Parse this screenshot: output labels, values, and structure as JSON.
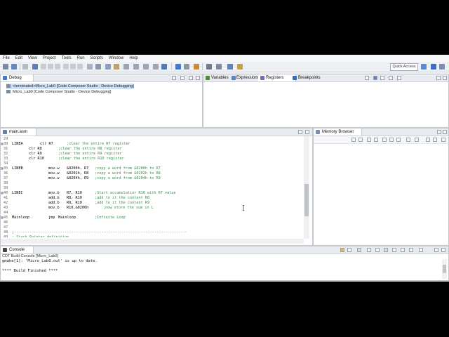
{
  "menu": [
    "File",
    "Edit",
    "View",
    "Project",
    "Tools",
    "Run",
    "Scripts",
    "Window",
    "Help"
  ],
  "toolbar": {
    "quick_access": "Quick Access"
  },
  "debug_view": {
    "tab": "Debug",
    "items": [
      {
        "label": "<terminated>Micro_Lab0 [Code Composer Studio - Device Debugging]",
        "selected": true
      },
      {
        "label": "Micro_Lab0 [Code Composer Studio - Device Debugging]",
        "selected": false
      }
    ]
  },
  "variables_view": {
    "tabs": [
      "Variables",
      "Expressions",
      "Registers",
      "Breakpoints"
    ],
    "active": "Registers"
  },
  "editor": {
    "tab": "main.asm",
    "lines": [
      {
        "n": "29",
        "label": "",
        "ins": "",
        "ops": "",
        "comment": ""
      },
      {
        "n": "30",
        "label": "LINEA",
        "ins": "clr R7",
        "ops": "",
        "comment": ";clear the entire R7 register"
      },
      {
        "n": "31",
        "label": "",
        "ins": "clr R8",
        "ops": "",
        "comment": ";clear the entire R8 register"
      },
      {
        "n": "32",
        "label": "",
        "ins": "clr R9",
        "ops": "",
        "comment": ";clear the entire R9 register"
      },
      {
        "n": "33",
        "label": "",
        "ins": "clr R10",
        "ops": "",
        "comment": ";clear the entire R10 register"
      },
      {
        "n": "34",
        "label": "",
        "ins": "",
        "ops": "",
        "comment": ""
      },
      {
        "n": "35",
        "label": "LINEB",
        "ins": "mov.w",
        "ops": "&0200h, R7",
        "comment": ";copy a word from &0200h to R7"
      },
      {
        "n": "36",
        "label": "",
        "ins": "mov.w",
        "ops": "&0202h, R8",
        "comment": ";copy a word from &0202h to R8"
      },
      {
        "n": "37",
        "label": "",
        "ins": "mov.w",
        "ops": "&0204h, R9",
        "comment": ";copy a word from &0204h to R9"
      },
      {
        "n": "38",
        "label": "",
        "ins": "",
        "ops": "",
        "comment": ""
      },
      {
        "n": "39",
        "label": "",
        "ins": "",
        "ops": "",
        "comment": ""
      },
      {
        "n": "40",
        "label": "LINEC",
        "ins": "mov.b",
        "ops": "R7, R10",
        "comment": ";Start accumulatior R10 with R7 value"
      },
      {
        "n": "41",
        "label": "",
        "ins": "add.b",
        "ops": "R8, R10",
        "comment": ";add to it the content R8"
      },
      {
        "n": "42",
        "label": "",
        "ins": "add.b",
        "ops": "R9, R10",
        "comment": ";add to it the content R9"
      },
      {
        "n": "43",
        "label": "",
        "ins": "mov.b",
        "ops": "R10,&0206h",
        "comment": ";now store the sum in L"
      },
      {
        "n": "44",
        "label": "",
        "ins": "",
        "ops": "",
        "comment": ""
      },
      {
        "n": "45",
        "label": "Mainloop",
        "ins": "jmp",
        "ops": "Mainloop",
        "comment": ";Infinite Loop"
      },
      {
        "n": "46",
        "label": "",
        "ins": "",
        "ops": "",
        "comment": ""
      },
      {
        "n": "47",
        "label": "",
        "ins": "",
        "ops": "",
        "comment": ""
      },
      {
        "n": "48",
        "label": "",
        "ins": "",
        "ops": "",
        "comment": ";-------------------------------------------------------------------------------"
      },
      {
        "n": "49",
        "label": "",
        "ins": "",
        "ops": "",
        "comment": "; Stack Pointer definition"
      }
    ]
  },
  "memory_view": {
    "tab": "Memory Browser"
  },
  "console_view": {
    "tab": "Console",
    "subtitle": "CDT Build Console [Micro_Lab0]",
    "lines": [
      "gmake[1]: 'Micro_Lab0.out' is up to date.",
      "",
      "**** Build Finished ****"
    ]
  },
  "colors": {
    "comment": "#3a8a50",
    "selection": "#cfe0f5",
    "panel_border": "#c4c8ce"
  }
}
